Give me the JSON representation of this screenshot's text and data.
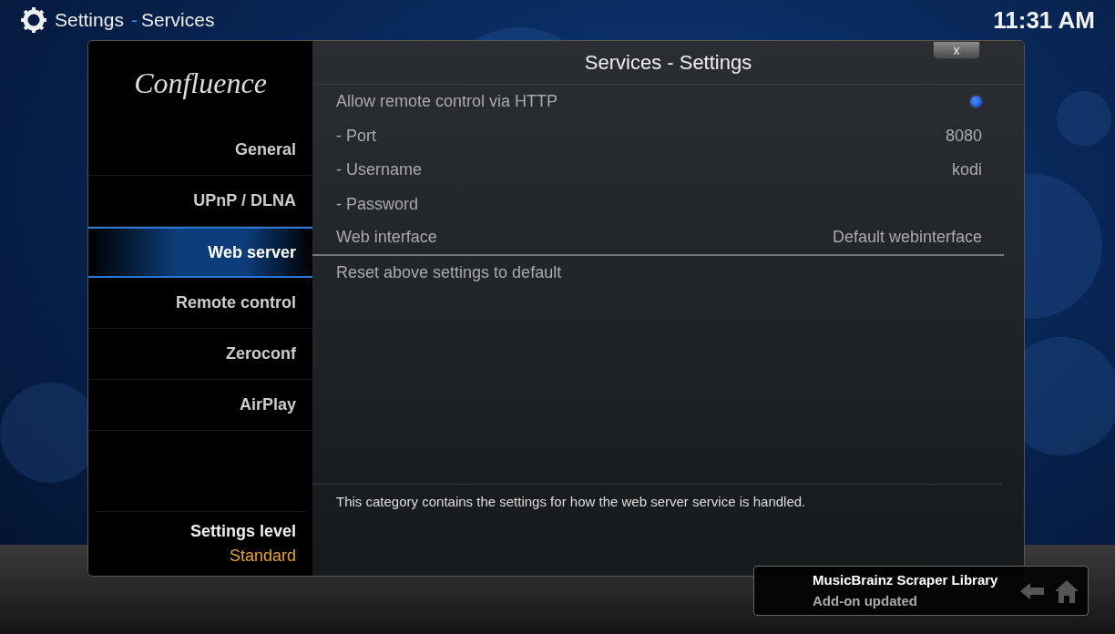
{
  "header": {
    "title": "Settings",
    "separator": "-",
    "section": "Services",
    "clock": "11:31 AM"
  },
  "sidebar": {
    "logo": "Confluence",
    "items": [
      {
        "label": "General",
        "selected": false
      },
      {
        "label": "UPnP / DLNA",
        "selected": false
      },
      {
        "label": "Web server",
        "selected": true
      },
      {
        "label": "Remote control",
        "selected": false
      },
      {
        "label": "Zeroconf",
        "selected": false
      },
      {
        "label": "AirPlay",
        "selected": false
      }
    ],
    "settings_level": {
      "label": "Settings level",
      "value": "Standard"
    }
  },
  "dialog": {
    "title": "Services - Settings",
    "close": "x",
    "settings": [
      {
        "kind": "toggle",
        "label": "Allow remote control via HTTP",
        "on": true
      },
      {
        "kind": "value",
        "label": "- Port",
        "value": "8080"
      },
      {
        "kind": "value",
        "label": "- Username",
        "value": "kodi"
      },
      {
        "kind": "value",
        "label": "- Password"
      },
      {
        "kind": "value",
        "label": "Web interface",
        "value": "Default webinterface"
      },
      {
        "kind": "action",
        "label": "Reset above settings to default"
      }
    ],
    "description": "This category contains the settings for how the web server service is handled."
  },
  "notification": {
    "title": "MusicBrainz Scraper Library",
    "message": "Add-on updated"
  }
}
